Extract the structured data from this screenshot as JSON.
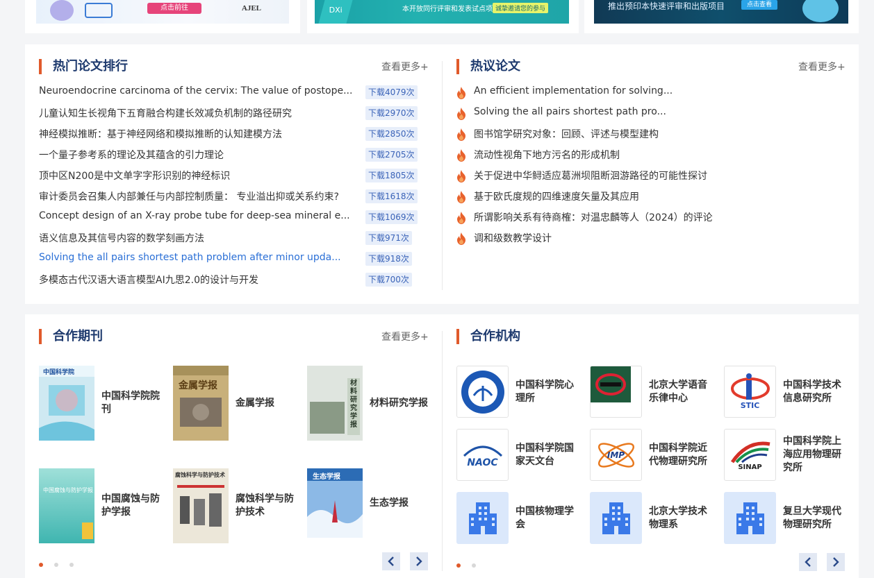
{
  "banners": [
    {
      "button": "点击前往",
      "mark": "AJEL"
    },
    {
      "text": "本开放同行评审和发表试点项目",
      "tag": "诚挚邀请您的参与",
      "mark": "DXi"
    },
    {
      "text": "推出预印本快速评审和出版项目",
      "button": "点击查看"
    }
  ],
  "hot_papers": {
    "title": "热门论文排行",
    "more": "查看更多+",
    "items": [
      {
        "title": "Neuroendocrine carcinoma of the cervix: The value of postope...",
        "downloads": "下载4079次"
      },
      {
        "title": "儿童认知生长视角下五育融合构建长效减负机制的路径研究",
        "downloads": "下载2970次"
      },
      {
        "title": "神经模拟推断：基于神经网络和模拟推断的认知建模方法",
        "downloads": "下载2850次"
      },
      {
        "title": "一个量子参考系的理论及其蕴含的引力理论",
        "downloads": "下载2705次"
      },
      {
        "title": "顶中区N200是中文单字字形识别的神经标识",
        "downloads": "下载1805次"
      },
      {
        "title": "审计委员会召集人内部兼任与内部控制质量： 专业溢出抑或关系约束?",
        "downloads": "下载1618次"
      },
      {
        "title": "Concept design of an X-ray probe tube for deep-sea mineral e...",
        "downloads": "下载1069次"
      },
      {
        "title": "语义信息及其信号内容的数学刻画方法",
        "downloads": "下载971次"
      },
      {
        "title": "Solving the all pairs shortest path problem after minor upda...",
        "downloads": "下载918次"
      },
      {
        "title": "多模态古代汉语大语言模型AI九思2.0的设计与开发",
        "downloads": "下载700次"
      }
    ]
  },
  "discussed": {
    "title": "热议论文",
    "more": "查看更多+",
    "icon": "fire-icon",
    "items": [
      "An efficient implementation for solving...",
      "Solving the all pairs shortest path pro...",
      "图书馆学研究对象：回顾、评述与模型建构",
      "流动性视角下地方污名的形成机制",
      "关于促进中华鲟适应葛洲坝阻断洄游路径的可能性探讨",
      "基于欧氏度规的四维速度矢量及其应用",
      "所谓影响关系有待商榷：对温忠麟等人（2024）的评论",
      "调和级数教学设计"
    ]
  },
  "journals": {
    "title": "合作期刊",
    "more": "查看更多+",
    "items": [
      {
        "name": "中国科学院院刊",
        "cover_title": "中国科学院"
      },
      {
        "name": "金属学报",
        "cover_title": "金属学报"
      },
      {
        "name": "材料研究学报",
        "cover_title": "材料研究学报"
      },
      {
        "name": "中国腐蚀与防护学报",
        "cover_title": "中国腐蚀与防护学报"
      },
      {
        "name": "腐蚀科学与防护技术",
        "cover_title": "腐蚀科学与防护技术"
      },
      {
        "name": "生态学报",
        "cover_title": "生态学报"
      }
    ],
    "page_count": 3,
    "current_page": 1
  },
  "institutions": {
    "title": "合作机构",
    "more": "查看更多+",
    "items": [
      {
        "name": "中国科学院心理所",
        "logo": "psych-seal-logo"
      },
      {
        "name": "北京大学语音乐律中心",
        "logo": "phonetics-logo"
      },
      {
        "name": "中国科学技术信息研究所",
        "logo": "istic-logo",
        "logo_text": "STIC"
      },
      {
        "name": "中国科学院国家天文台",
        "logo": "naoc-logo",
        "logo_text": "NAOC"
      },
      {
        "name": "中国科学院近代物理研究所",
        "logo": "imp-logo",
        "logo_text": "IMP"
      },
      {
        "name": "中国科学院上海应用物理研究所",
        "logo": "sinap-logo",
        "logo_text": "SINAP"
      },
      {
        "name": "中国核物理学会",
        "logo": "building-icon"
      },
      {
        "name": "北京大学技术物理系",
        "logo": "building-icon"
      },
      {
        "name": "复旦大学现代物理研究所",
        "logo": "building-icon"
      }
    ],
    "page_count": 2,
    "current_page": 1
  },
  "colors": {
    "accent": "#e05a2b",
    "title": "#1e3a6e",
    "badge_bg": "#e7eefa",
    "badge_text": "#3a63b8",
    "link_hover": "#2a6fd6"
  }
}
